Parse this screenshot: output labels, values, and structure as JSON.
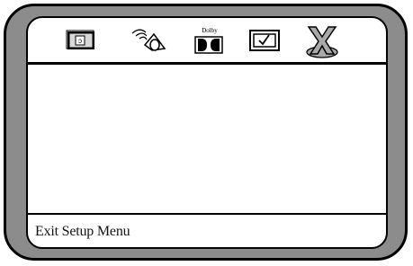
{
  "status_bar": {
    "text": "Exit Setup Menu"
  },
  "toolbar": {
    "icons": [
      {
        "name": "general-setup-icon",
        "selected": false
      },
      {
        "name": "speaker-audio-icon",
        "selected": false
      },
      {
        "name": "dolby-icon",
        "label": "Dolby",
        "selected": false
      },
      {
        "name": "preference-check-icon",
        "selected": false
      },
      {
        "name": "exit-icon",
        "selected": true
      }
    ]
  },
  "colors": {
    "bezel": "#8c8c8c",
    "screen": "#ffffff",
    "outline": "#000000",
    "exit_icon_fill": "#a9a9a9"
  }
}
